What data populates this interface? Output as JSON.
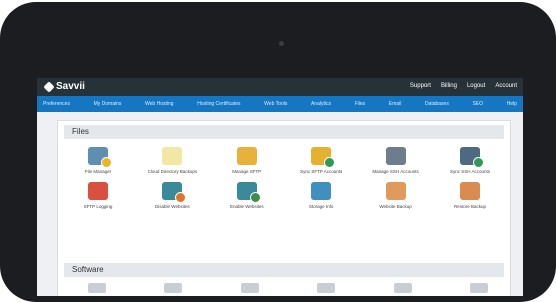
{
  "topbar": {
    "logo_text": "Savvii",
    "links": [
      "Support",
      "Billing",
      "Logout",
      "Account"
    ]
  },
  "nav": {
    "items": [
      "Preferences",
      "My Domains",
      "Web Hosting",
      "Hosting Certificates",
      "Web Tools",
      "Analytics",
      "Files",
      "Email",
      "Databases",
      "SEO",
      "Help"
    ]
  },
  "files": {
    "title": "Files",
    "tiles": [
      {
        "label": "File Manager",
        "icon": "folder-icon",
        "color": "#5f8fb0",
        "badge": "#e8b52c"
      },
      {
        "label": "Cloud Directory Backups",
        "icon": "directory-icon",
        "color": "#f3e7a4",
        "badge": ""
      },
      {
        "label": "Manage SFTP",
        "icon": "sftp-icon",
        "color": "#e8b23a",
        "badge": ""
      },
      {
        "label": "Sync SFTP Accounts",
        "icon": "sftp-sync-icon",
        "color": "#e6b12f",
        "badge": "#2f9a57"
      },
      {
        "label": "Manage SSH Accounts",
        "icon": "ssh-icon",
        "color": "#6d7d8b",
        "badge": ""
      },
      {
        "label": "Sync SSH Accounts",
        "icon": "ssh-sync-icon",
        "color": "#4d6a80",
        "badge": "#2f9a57"
      },
      {
        "label": "SFTP Logging",
        "icon": "sftp-log-icon",
        "color": "#d9503f",
        "badge": ""
      },
      {
        "label": "Disable Websites",
        "icon": "disable-icon",
        "color": "#3a8a9a",
        "badge": "#e0752a"
      },
      {
        "label": "Enable Websites",
        "icon": "enable-icon",
        "color": "#3a8a9a",
        "badge": "#3f8d4a"
      },
      {
        "label": "Storage Info",
        "icon": "storage-icon",
        "color": "#3f8fbf",
        "badge": ""
      },
      {
        "label": "Website Backup",
        "icon": "website-backup-icon",
        "color": "#e09a5b",
        "badge": ""
      },
      {
        "label": "Restore Backup",
        "icon": "restore-backup-icon",
        "color": "#d98b50",
        "badge": ""
      }
    ]
  },
  "software": {
    "title": "Software"
  }
}
